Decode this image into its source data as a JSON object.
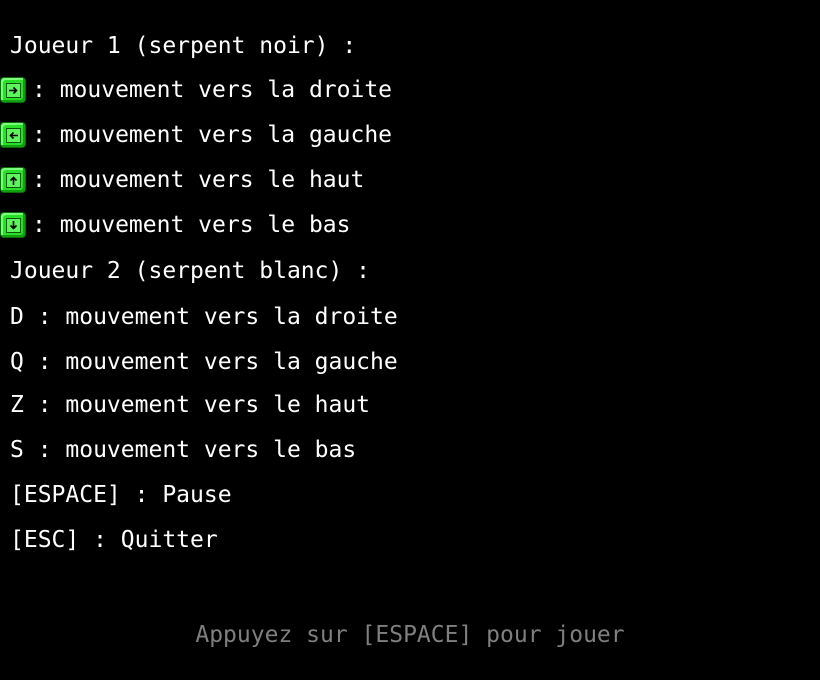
{
  "player1": {
    "header": "Joueur 1 (serpent noir) :",
    "controls": [
      {
        "icon": "arrow-right-key-icon",
        "label": ": mouvement vers la droite"
      },
      {
        "icon": "arrow-left-key-icon",
        "label": ": mouvement vers la gauche"
      },
      {
        "icon": "arrow-up-key-icon",
        "label": ": mouvement vers le haut"
      },
      {
        "icon": "arrow-down-key-icon",
        "label": ": mouvement vers le bas"
      }
    ]
  },
  "player2": {
    "header": "Joueur 2 (serpent blanc) :",
    "controls": [
      "D : mouvement vers la droite",
      "Q : mouvement vers la gauche",
      "Z : mouvement vers le haut",
      "S : mouvement vers le bas"
    ]
  },
  "general": {
    "pause": "[ESPACE] : Pause",
    "quit": "[ESC] : Quitter"
  },
  "prompt": "Appuyez sur [ESPACE] pour jouer",
  "colors": {
    "background": "#000000",
    "text": "#ffffff",
    "prompt": "#7f7f7f",
    "key_icon": "#28e028"
  }
}
